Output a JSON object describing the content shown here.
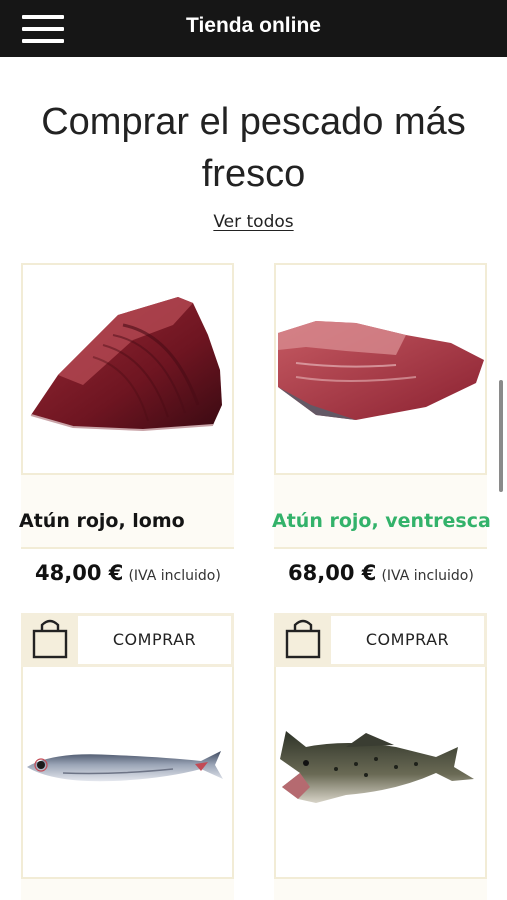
{
  "header": {
    "title": "Tienda online",
    "menu_icon": "hamburger-menu-icon",
    "background": "#161616"
  },
  "section": {
    "title": "Comprar el pescado más fresco",
    "see_all": "Ver todos"
  },
  "products": [
    {
      "name": "Atún rojo, lomo",
      "price": "48,00 €",
      "tax_note": "(IVA incluido)",
      "image": "tuna-loin-image"
    },
    {
      "name": "Atún rojo, ventresca",
      "price": "68,00 €",
      "tax_note": "(IVA incluido)",
      "image": "tuna-belly-image",
      "name_color": "#33b26a"
    },
    {
      "buy_label": "COMPRAR",
      "image": "anchovy-fish-image",
      "icon": "shopping-bag-icon"
    },
    {
      "buy_label": "COMPRAR",
      "image": "cod-fish-image",
      "icon": "shopping-bag-icon"
    }
  ],
  "colors": {
    "card_border": "#f2ecd6",
    "buy_bar": "#f4eedc",
    "accent_green": "#33b26a"
  }
}
